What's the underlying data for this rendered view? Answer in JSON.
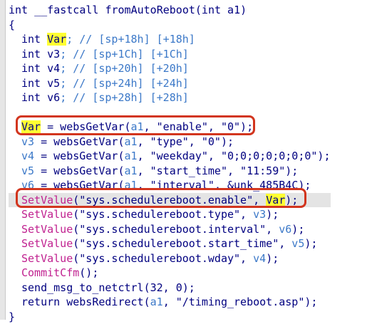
{
  "colors": {
    "text": "#000080",
    "comment": "#3b78c8",
    "highlight": "#ffff33",
    "callout": "#d2351e",
    "pink_func": "#c0208f"
  },
  "code": {
    "signature": "int __fastcall fromAutoReboot(int a1)",
    "open_brace": "{",
    "decl_var": {
      "type": "int ",
      "name": "Var",
      "comment": "; // [sp+18h] [+18h]"
    },
    "decl_v3": {
      "type": "int ",
      "name": "v3",
      "comment": "; // [sp+1Ch] [+1Ch]"
    },
    "decl_v4": {
      "type": "int ",
      "name": "v4",
      "comment": "; // [sp+20h] [+20h]"
    },
    "decl_v5": {
      "type": "int ",
      "name": "v5",
      "comment": "; // [sp+24h] [+24h]"
    },
    "decl_v6": {
      "type": "int ",
      "name": "v6",
      "comment": "; // [sp+28h] [+28h]"
    },
    "stmt_var": {
      "lhs": "Var",
      "rest": " = websGetVar(",
      "arg": "a1",
      "tail": ", \"enable\", \"0\");"
    },
    "stmt_v3": {
      "lhs": "v3",
      "rest": " = websGetVar(",
      "arg": "a1",
      "tail": ", \"type\", \"0\");"
    },
    "stmt_v4": {
      "lhs": "v4",
      "rest": " = websGetVar(",
      "arg": "a1",
      "tail": ", \"weekday\", \"0;0;0;0;0;0;0\");"
    },
    "stmt_v5": {
      "lhs": "v5",
      "rest": " = websGetVar(",
      "arg": "a1",
      "tail": ", \"start_time\", \"11:59\");"
    },
    "stmt_v6": {
      "lhs": "v6",
      "rest": " = websGetVar(",
      "arg": "a1",
      "tail": ", \"interval\", &unk_485B4C);"
    },
    "set_enable": {
      "fn": "SetValue",
      "args": "(\"sys.schedulereboot.enable\", ",
      "var": "Var",
      "close": ");"
    },
    "set_type": {
      "fn": "SetValue",
      "args": "(\"sys.schedulereboot.type\", ",
      "var": "v3",
      "close": ");"
    },
    "set_interval": {
      "fn": "SetValue",
      "args": "(\"sys.schedulereboot.interval\", ",
      "var": "v6",
      "close": ");"
    },
    "set_start": {
      "fn": "SetValue",
      "args": "(\"sys.schedulereboot.start_time\", ",
      "var": "v5",
      "close": ");"
    },
    "set_wday": {
      "fn": "SetValue",
      "args": "(\"sys.schedulereboot.wday\", ",
      "var": "v4",
      "close": ");"
    },
    "commit": {
      "fn": "CommitCfm",
      "close": "();"
    },
    "send_msg": "send_msg_to_netctrl(32, 0);",
    "ret": {
      "kw": "return ",
      "call": "websRedirect(",
      "arg": "a1",
      "tail": ", \"/timing_reboot.asp\");"
    },
    "close_brace": "}"
  }
}
